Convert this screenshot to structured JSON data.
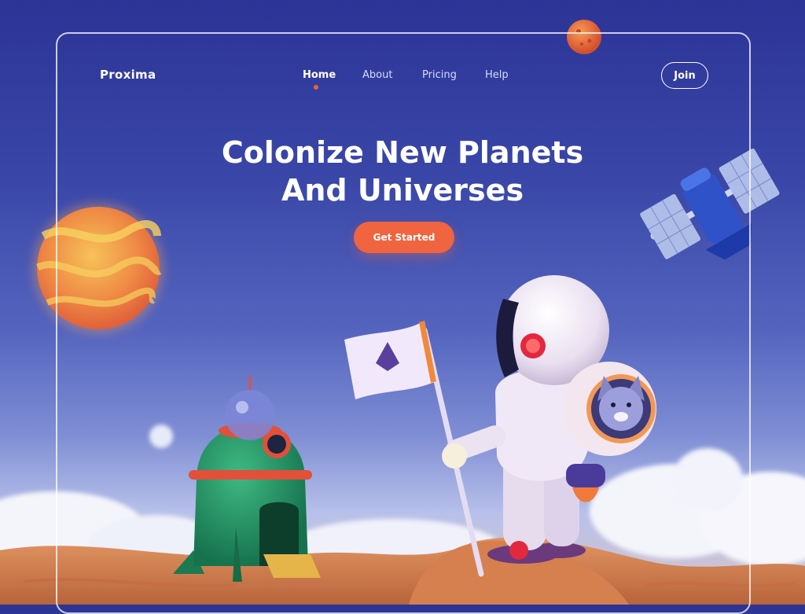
{
  "brand": {
    "name": "Proxima"
  },
  "nav": {
    "items": [
      {
        "label": "Home",
        "active": true
      },
      {
        "label": "About",
        "active": false
      },
      {
        "label": "Pricing",
        "active": false
      },
      {
        "label": "Help",
        "active": false
      }
    ]
  },
  "header": {
    "join_label": "Join"
  },
  "hero": {
    "title_line1": "Colonize New Planets",
    "title_line2": "And Universes",
    "cta_label": "Get Started"
  },
  "colors": {
    "background_top": "#2c3496",
    "accent": "#f0643f",
    "text": "#ffffff"
  }
}
